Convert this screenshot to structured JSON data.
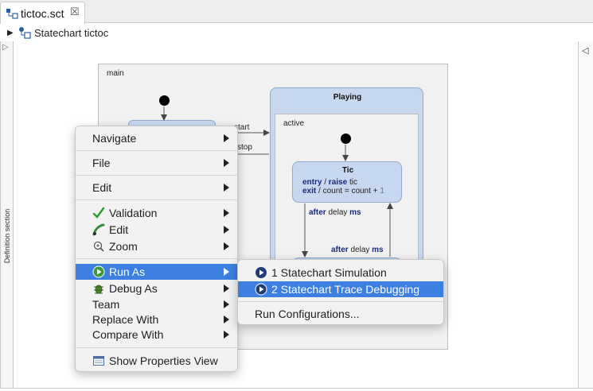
{
  "tab": {
    "title": "tictoc.sct"
  },
  "breadcrumb": {
    "label": "Statechart tictoc"
  },
  "definition_panel": {
    "label": "Definition section"
  },
  "canvas": {
    "main_region_label": "main",
    "playing_state_label": "Playing",
    "active_region_label": "active",
    "tic_state": {
      "name": "Tic",
      "entry_kw": "entry",
      "entry_sep": "/",
      "raise_kw": "raise",
      "entry_event": "tic",
      "exit_kw": "exit",
      "exit_sep": "/",
      "exit_expr": "count = count +",
      "exit_num": "1"
    },
    "transitions": {
      "start": "start",
      "stop": "stop",
      "down_after": "after",
      "down_rest": "delay",
      "down_unit": "ms",
      "up_after": "after",
      "up_rest": "delay",
      "up_unit": "ms"
    }
  },
  "context_menu": {
    "items": [
      {
        "label": "Navigate"
      },
      {
        "label": "File"
      },
      {
        "label": "Edit"
      },
      {
        "label": "Validation"
      },
      {
        "label": "Edit"
      },
      {
        "label": "Zoom"
      },
      {
        "label": "Run As"
      },
      {
        "label": "Debug As"
      },
      {
        "label": "Team"
      },
      {
        "label": "Replace With"
      },
      {
        "label": "Compare With"
      },
      {
        "label": "Show Properties View"
      }
    ]
  },
  "submenu": {
    "items": [
      {
        "label": "1 Statechart Simulation"
      },
      {
        "label": "2 Statechart Trace Debugging"
      },
      {
        "label": "Run Configurations..."
      }
    ]
  },
  "colors": {
    "selection": "#3c7fe0",
    "state_fill": "#c6d7ef",
    "state_border": "#8fa9cf"
  }
}
